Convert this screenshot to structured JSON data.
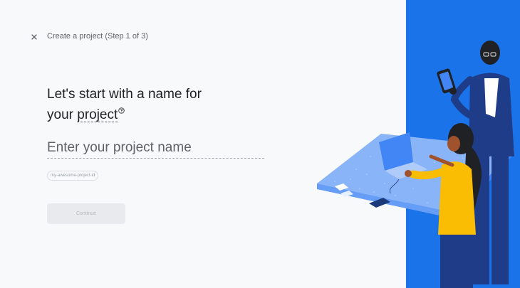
{
  "header": {
    "close_icon": "close-icon",
    "step_title": "Create a project (Step 1 of 3)"
  },
  "main": {
    "heading_line1": "Let's start with a name for",
    "heading_prefix": "your",
    "heading_link": "project",
    "help_icon": "help-circle-icon",
    "project_name_placeholder": "Enter your project name",
    "project_name_value": "",
    "project_id_chip": "my-awesome-project-id",
    "continue_label": "Continue"
  },
  "colors": {
    "accent_blue": "#1a73e8",
    "text_primary": "#202124",
    "text_secondary": "#5f6368",
    "background": "#f8f9fa"
  }
}
